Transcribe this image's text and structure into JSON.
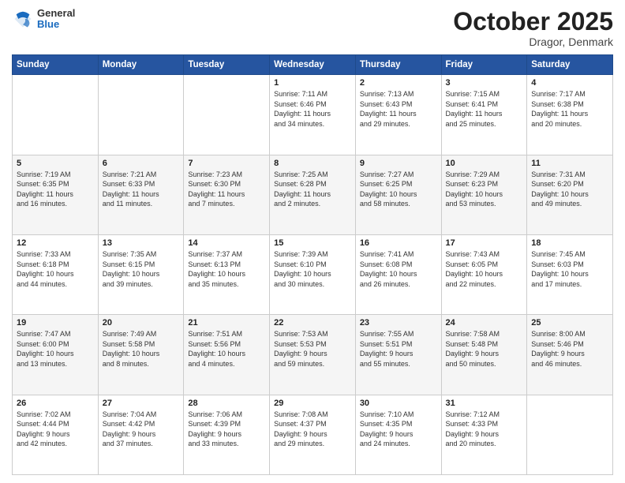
{
  "header": {
    "logo": {
      "general": "General",
      "blue": "Blue"
    },
    "title": "October 2025",
    "location": "Dragor, Denmark"
  },
  "weekdays": [
    "Sunday",
    "Monday",
    "Tuesday",
    "Wednesday",
    "Thursday",
    "Friday",
    "Saturday"
  ],
  "weeks": [
    [
      {
        "day": "",
        "info": ""
      },
      {
        "day": "",
        "info": ""
      },
      {
        "day": "",
        "info": ""
      },
      {
        "day": "1",
        "info": "Sunrise: 7:11 AM\nSunset: 6:46 PM\nDaylight: 11 hours\nand 34 minutes."
      },
      {
        "day": "2",
        "info": "Sunrise: 7:13 AM\nSunset: 6:43 PM\nDaylight: 11 hours\nand 29 minutes."
      },
      {
        "day": "3",
        "info": "Sunrise: 7:15 AM\nSunset: 6:41 PM\nDaylight: 11 hours\nand 25 minutes."
      },
      {
        "day": "4",
        "info": "Sunrise: 7:17 AM\nSunset: 6:38 PM\nDaylight: 11 hours\nand 20 minutes."
      }
    ],
    [
      {
        "day": "5",
        "info": "Sunrise: 7:19 AM\nSunset: 6:35 PM\nDaylight: 11 hours\nand 16 minutes."
      },
      {
        "day": "6",
        "info": "Sunrise: 7:21 AM\nSunset: 6:33 PM\nDaylight: 11 hours\nand 11 minutes."
      },
      {
        "day": "7",
        "info": "Sunrise: 7:23 AM\nSunset: 6:30 PM\nDaylight: 11 hours\nand 7 minutes."
      },
      {
        "day": "8",
        "info": "Sunrise: 7:25 AM\nSunset: 6:28 PM\nDaylight: 11 hours\nand 2 minutes."
      },
      {
        "day": "9",
        "info": "Sunrise: 7:27 AM\nSunset: 6:25 PM\nDaylight: 10 hours\nand 58 minutes."
      },
      {
        "day": "10",
        "info": "Sunrise: 7:29 AM\nSunset: 6:23 PM\nDaylight: 10 hours\nand 53 minutes."
      },
      {
        "day": "11",
        "info": "Sunrise: 7:31 AM\nSunset: 6:20 PM\nDaylight: 10 hours\nand 49 minutes."
      }
    ],
    [
      {
        "day": "12",
        "info": "Sunrise: 7:33 AM\nSunset: 6:18 PM\nDaylight: 10 hours\nand 44 minutes."
      },
      {
        "day": "13",
        "info": "Sunrise: 7:35 AM\nSunset: 6:15 PM\nDaylight: 10 hours\nand 39 minutes."
      },
      {
        "day": "14",
        "info": "Sunrise: 7:37 AM\nSunset: 6:13 PM\nDaylight: 10 hours\nand 35 minutes."
      },
      {
        "day": "15",
        "info": "Sunrise: 7:39 AM\nSunset: 6:10 PM\nDaylight: 10 hours\nand 30 minutes."
      },
      {
        "day": "16",
        "info": "Sunrise: 7:41 AM\nSunset: 6:08 PM\nDaylight: 10 hours\nand 26 minutes."
      },
      {
        "day": "17",
        "info": "Sunrise: 7:43 AM\nSunset: 6:05 PM\nDaylight: 10 hours\nand 22 minutes."
      },
      {
        "day": "18",
        "info": "Sunrise: 7:45 AM\nSunset: 6:03 PM\nDaylight: 10 hours\nand 17 minutes."
      }
    ],
    [
      {
        "day": "19",
        "info": "Sunrise: 7:47 AM\nSunset: 6:00 PM\nDaylight: 10 hours\nand 13 minutes."
      },
      {
        "day": "20",
        "info": "Sunrise: 7:49 AM\nSunset: 5:58 PM\nDaylight: 10 hours\nand 8 minutes."
      },
      {
        "day": "21",
        "info": "Sunrise: 7:51 AM\nSunset: 5:56 PM\nDaylight: 10 hours\nand 4 minutes."
      },
      {
        "day": "22",
        "info": "Sunrise: 7:53 AM\nSunset: 5:53 PM\nDaylight: 9 hours\nand 59 minutes."
      },
      {
        "day": "23",
        "info": "Sunrise: 7:55 AM\nSunset: 5:51 PM\nDaylight: 9 hours\nand 55 minutes."
      },
      {
        "day": "24",
        "info": "Sunrise: 7:58 AM\nSunset: 5:48 PM\nDaylight: 9 hours\nand 50 minutes."
      },
      {
        "day": "25",
        "info": "Sunrise: 8:00 AM\nSunset: 5:46 PM\nDaylight: 9 hours\nand 46 minutes."
      }
    ],
    [
      {
        "day": "26",
        "info": "Sunrise: 7:02 AM\nSunset: 4:44 PM\nDaylight: 9 hours\nand 42 minutes."
      },
      {
        "day": "27",
        "info": "Sunrise: 7:04 AM\nSunset: 4:42 PM\nDaylight: 9 hours\nand 37 minutes."
      },
      {
        "day": "28",
        "info": "Sunrise: 7:06 AM\nSunset: 4:39 PM\nDaylight: 9 hours\nand 33 minutes."
      },
      {
        "day": "29",
        "info": "Sunrise: 7:08 AM\nSunset: 4:37 PM\nDaylight: 9 hours\nand 29 minutes."
      },
      {
        "day": "30",
        "info": "Sunrise: 7:10 AM\nSunset: 4:35 PM\nDaylight: 9 hours\nand 24 minutes."
      },
      {
        "day": "31",
        "info": "Sunrise: 7:12 AM\nSunset: 4:33 PM\nDaylight: 9 hours\nand 20 minutes."
      },
      {
        "day": "",
        "info": ""
      }
    ]
  ]
}
